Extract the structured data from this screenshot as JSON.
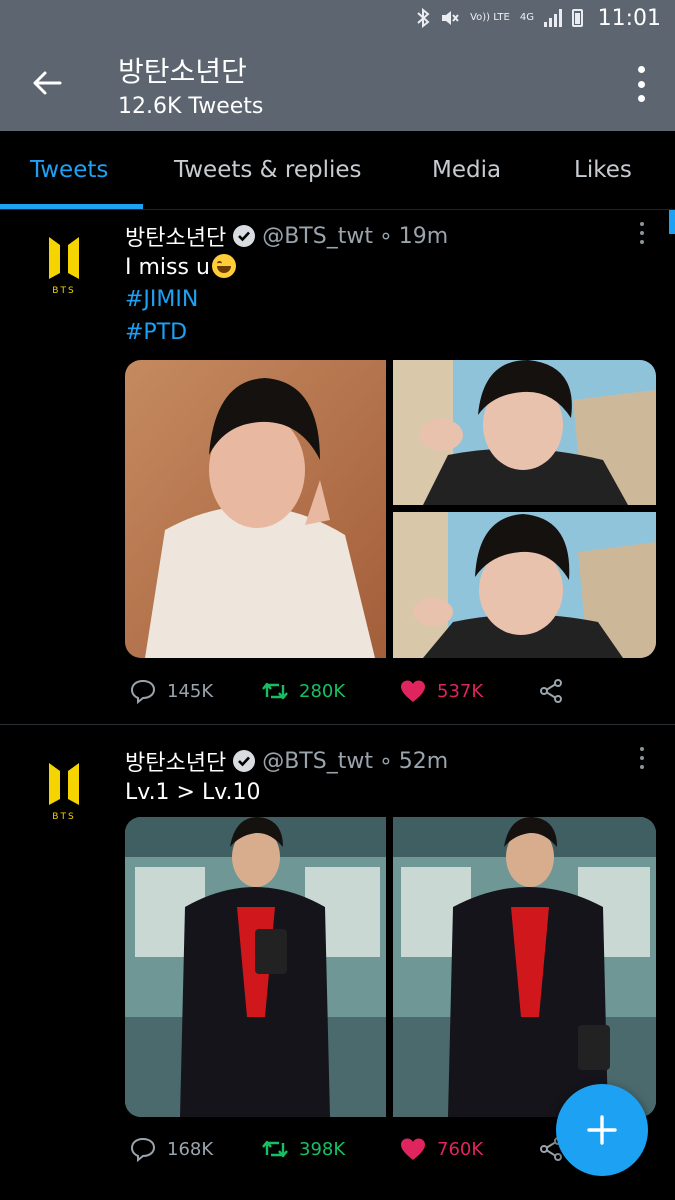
{
  "status_bar": {
    "time": "11:01",
    "network_label": "4G",
    "volte_label": "Vo)) LTE",
    "icons": [
      "bluetooth-icon",
      "mute-icon",
      "volte-icon",
      "network-4g-icon",
      "signal-icon",
      "battery-icon"
    ]
  },
  "header": {
    "title": "방탄소년단",
    "subtitle": "12.6K Tweets",
    "back_icon": "back-arrow-icon",
    "menu_icon": "more-vertical-icon"
  },
  "tabs": [
    {
      "label": "Tweets",
      "active": true
    },
    {
      "label": "Tweets & replies",
      "active": false
    },
    {
      "label": "Media",
      "active": false
    },
    {
      "label": "Likes",
      "active": false
    }
  ],
  "tweets": [
    {
      "name": "방탄소년단",
      "handle": "@BTS_twt",
      "time": "19m",
      "text": "I miss u",
      "emoji": "face-with-tears-of-joy",
      "hashtags": [
        "#JIMIN",
        "#PTD"
      ],
      "avatar_label": "BTS",
      "replies": "145K",
      "retweets": "280K",
      "likes": "537K"
    },
    {
      "name": "방탄소년단",
      "handle": "@BTS_twt",
      "time": "52m",
      "text": "Lv.1 > Lv.10",
      "avatar_label": "BTS",
      "replies": "168K",
      "retweets": "398K",
      "likes": "760K"
    }
  ],
  "colors": {
    "accent": "#1da1f2",
    "appbar": "#5d6670",
    "retweet": "#17bf63",
    "like": "#e0245e",
    "brand_yellow": "#f5d400"
  },
  "fab_icon": "compose-plus-icon"
}
